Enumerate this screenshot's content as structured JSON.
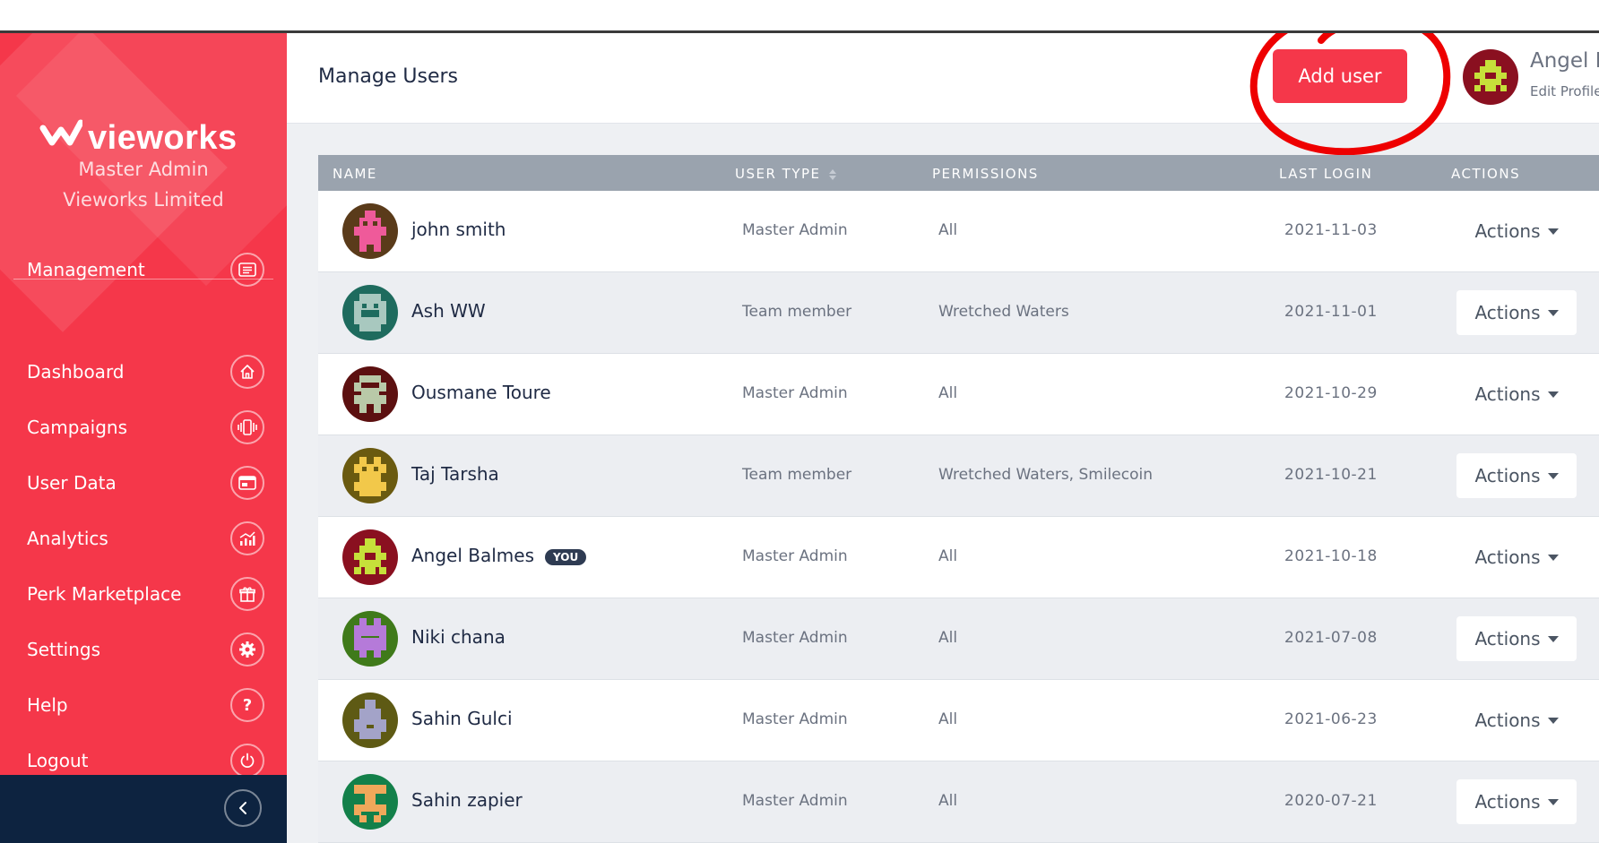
{
  "brand": {
    "name": "vieworks"
  },
  "org": {
    "role": "Master Admin",
    "name": "Vieworks Limited"
  },
  "sidebar": {
    "items": [
      {
        "label": "Management",
        "icon": "list-icon"
      },
      {
        "label": "Dashboard",
        "icon": "home-icon"
      },
      {
        "label": "Campaigns",
        "icon": "vibrate-phone-icon"
      },
      {
        "label": "User Data",
        "icon": "id-card-icon"
      },
      {
        "label": "Analytics",
        "icon": "chart-icon"
      },
      {
        "label": "Perk Marketplace",
        "icon": "gift-icon"
      },
      {
        "label": "Settings",
        "icon": "gear-icon"
      },
      {
        "label": "Help",
        "icon": "question-icon"
      },
      {
        "label": "Logout",
        "icon": "power-icon"
      }
    ]
  },
  "header": {
    "title": "Manage Users",
    "add_label": "Add user",
    "user_name": "Angel B",
    "edit_profile": "Edit Profile"
  },
  "table": {
    "columns": {
      "name": "NAME",
      "user_type": "USER TYPE",
      "permissions": "PERMISSIONS",
      "last_login": "LAST LOGIN",
      "actions": "ACTIONS"
    },
    "you_badge": "YOU",
    "actions_label": "Actions",
    "rows": [
      {
        "name": "john smith",
        "user_type": "Master Admin",
        "permissions": "All",
        "last_login": "2021-11-03"
      },
      {
        "name": "Ash WW",
        "user_type": "Team member",
        "permissions": "Wretched Waters",
        "last_login": "2021-11-01"
      },
      {
        "name": "Ousmane Toure",
        "user_type": "Master Admin",
        "permissions": "All",
        "last_login": "2021-10-29"
      },
      {
        "name": "Taj Tarsha",
        "user_type": "Team member",
        "permissions": "Wretched Waters, Smilecoin",
        "last_login": "2021-10-21"
      },
      {
        "name": "Angel Balmes",
        "user_type": "Master Admin",
        "permissions": "All",
        "last_login": "2021-10-18"
      },
      {
        "name": "Niki chana",
        "user_type": "Master Admin",
        "permissions": "All",
        "last_login": "2021-07-08"
      },
      {
        "name": "Sahin Gulci",
        "user_type": "Master Admin",
        "permissions": "All",
        "last_login": "2021-06-23"
      },
      {
        "name": "Sahin zapier",
        "user_type": "Master Admin",
        "permissions": "All",
        "last_login": "2020-07-21"
      }
    ]
  },
  "colors": {
    "brand_red": "#f5374a",
    "sidebar_footer": "#0d2340",
    "table_header": "#9aa3ae",
    "annotation_red": "#ee0000"
  }
}
